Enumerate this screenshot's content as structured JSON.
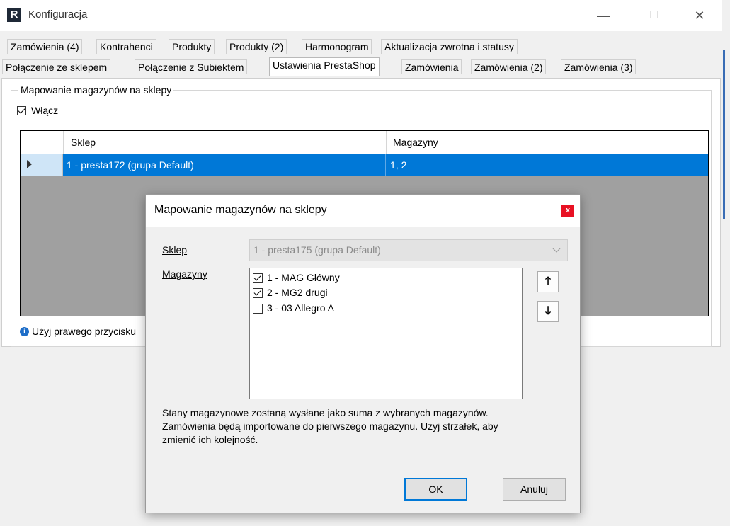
{
  "window": {
    "logo": "R",
    "title": "Konfiguracja",
    "minimize_glyph": "—",
    "maximize_glyph": "☐",
    "close_glyph": "✕"
  },
  "tabs_row1": [
    "Zamówienia (4)",
    "Kontrahenci",
    "Produkty",
    "Produkty (2)",
    "Harmonogram",
    "Aktualizacja zwrotna i statusy"
  ],
  "tabs_row2": [
    "Połączenie ze sklepem",
    "Połączenie z Subiektem",
    "Ustawienia PrestaShop",
    "Zamówienia",
    "Zamówienia (2)",
    "Zamówienia (3)"
  ],
  "active_tab": "Ustawienia PrestaShop",
  "group": {
    "title": "Mapowanie magazynów na sklepy",
    "enable_label": "Włącz",
    "enable_checked": true
  },
  "grid": {
    "columns": [
      "Sklep",
      "Magazyny"
    ],
    "rows": [
      {
        "sklep": "1 - presta172 (grupa Default)",
        "magazyny": "1, 2"
      }
    ]
  },
  "info": {
    "icon": "info-icon",
    "text": "Użyj prawego przycisku"
  },
  "dialog": {
    "title": "Mapowanie magazynów na sklepy",
    "close_glyph": "x",
    "sklep_label": "Sklep",
    "sklep_value": "1 - presta175 (grupa Default)",
    "magazyny_label": "Magazyny",
    "warehouses": [
      {
        "label": "1 - MAG Główny",
        "checked": true
      },
      {
        "label": "2 - MG2 drugi",
        "checked": true
      },
      {
        "label": "3 - 03 Allegro A",
        "checked": false
      }
    ],
    "up_glyph": "🡑",
    "down_glyph": "🡓",
    "description_lines": [
      "Stany magazynowe zostaną wysłane jako suma z wybranych magazynów.",
      "Zamówienia będą importowane do pierwszego magazynu. Użyj strzałek, aby",
      "zmienić ich kolejność."
    ],
    "ok_label": "OK",
    "cancel_label": "Anuluj"
  },
  "colors": {
    "selection": "#0078d7",
    "close_red": "#e81123"
  }
}
